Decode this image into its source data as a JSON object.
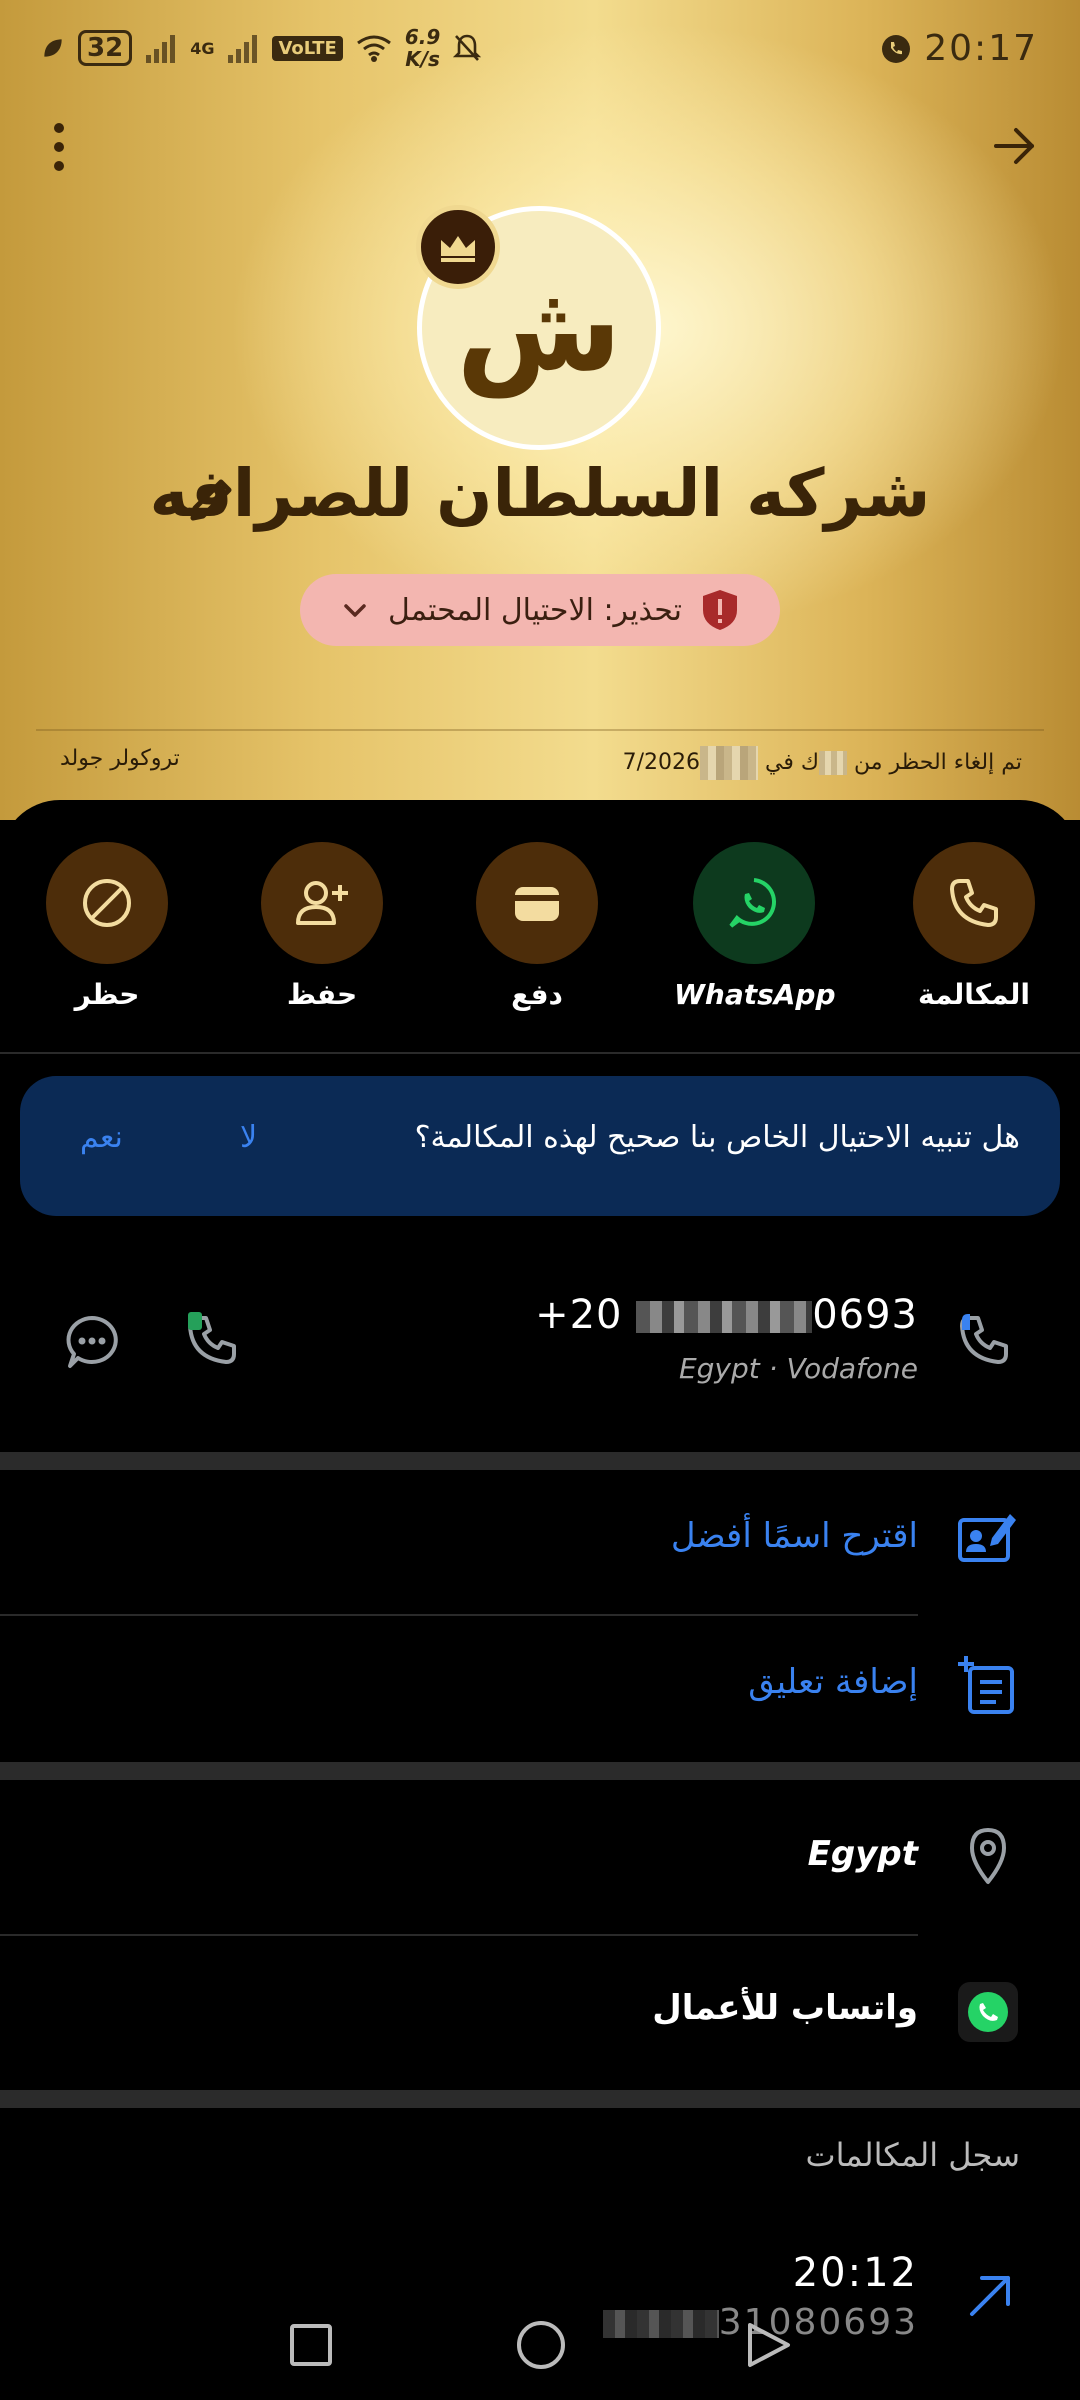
{
  "status_bar": {
    "battery": "32",
    "network": "4G",
    "volte": "VoLTE",
    "speed_value": "6.9",
    "speed_unit": "K/s",
    "time": "20:17"
  },
  "contact": {
    "avatar_letter": "ش",
    "name": "شركه السلطان للصرافه",
    "fraud_warning": "تحذير: الاحتيال المحتمل",
    "unblock_prefix": "تم إلغاء الحظر من",
    "unblock_mid": "ك في",
    "unblock_suffix": "7/2026",
    "gold_label": "تروكولر جولد"
  },
  "actions": [
    {
      "label": "المكالمة",
      "icon": "phone-icon"
    },
    {
      "label": "WhatsApp",
      "icon": "whatsapp-icon"
    },
    {
      "label": "دفع",
      "icon": "wallet-icon"
    },
    {
      "label": "حفظ",
      "icon": "add-contact-icon"
    },
    {
      "label": "حظر",
      "icon": "block-icon"
    }
  ],
  "feedback": {
    "question": "هل تنبيه الاحتيال الخاص بنا صحيح لهذه المكالمة؟",
    "no_label": "لا",
    "yes_label": "نعم"
  },
  "number": {
    "prefix": "+20",
    "suffix": "0693",
    "carrier": "Egypt · Vodafone"
  },
  "rows": {
    "suggest_name": "اقترح اسمًا أفضل",
    "add_comment": "إضافة تعليق",
    "location": "Egypt",
    "whatsapp_business": "واتساب للأعمال"
  },
  "history": {
    "title": "سجل المكالمات",
    "time": "20:12",
    "number_suffix": "31080693"
  },
  "colors": {
    "accent_blue": "#3a82f0",
    "action_brown": "#4d2d0a",
    "whatsapp_green": "#25d366"
  }
}
